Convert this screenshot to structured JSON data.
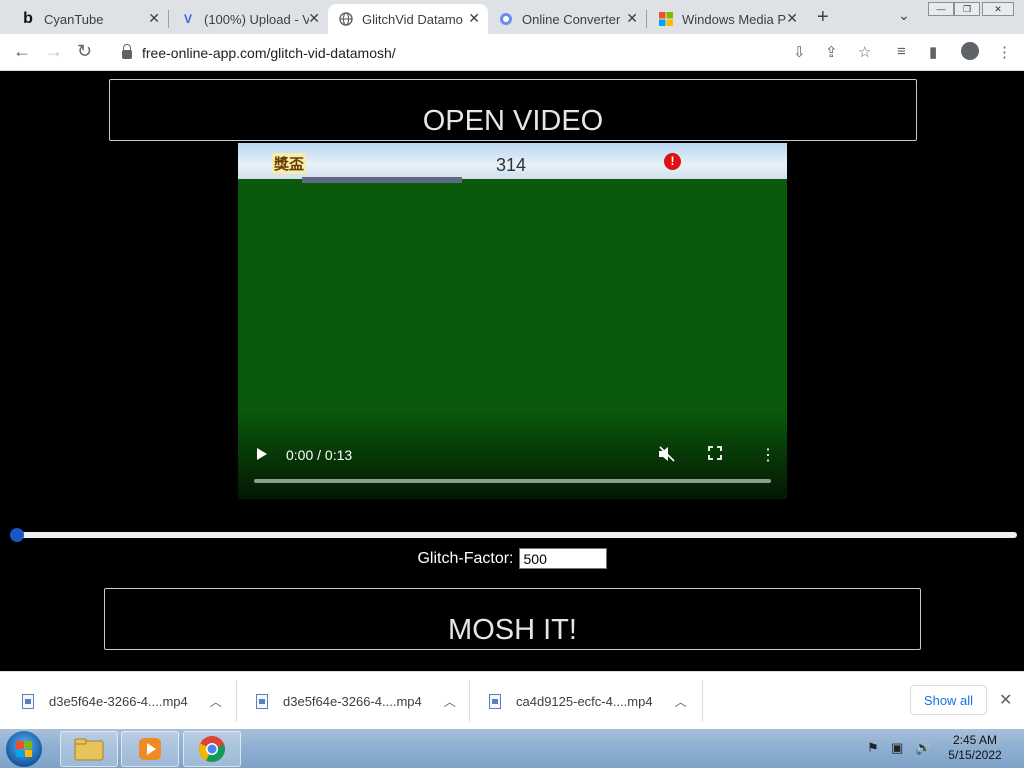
{
  "browser": {
    "tabs": [
      {
        "label": "CyanTube",
        "icon": "b",
        "active": false
      },
      {
        "label": "(100%) Upload - V",
        "icon": "V",
        "active": false
      },
      {
        "label": "GlitchVid Datamo",
        "icon": "globe",
        "active": true
      },
      {
        "label": "Online Converter",
        "icon": "converter",
        "active": false
      },
      {
        "label": "Windows Media P",
        "icon": "windows",
        "active": false
      }
    ],
    "url": "free-online-app.com/glitch-vid-datamosh/"
  },
  "page": {
    "open_video_label": "OPEN VIDEO",
    "video": {
      "time": "0:00 / 0:13",
      "overlay_text_cn": "獎盃",
      "overlay_text_num": "314",
      "alert_mark": "!"
    },
    "glitch_factor_label": "Glitch-Factor:",
    "glitch_factor_value": "500",
    "mosh_label": "MOSH IT!"
  },
  "downloads": {
    "items": [
      {
        "name": "d3e5f64e-3266-4....mp4"
      },
      {
        "name": "d3e5f64e-3266-4....mp4"
      },
      {
        "name": "ca4d9125-ecfc-4....mp4"
      }
    ],
    "show_all_label": "Show all"
  },
  "taskbar": {
    "time": "2:45 AM",
    "date": "5/15/2022"
  }
}
